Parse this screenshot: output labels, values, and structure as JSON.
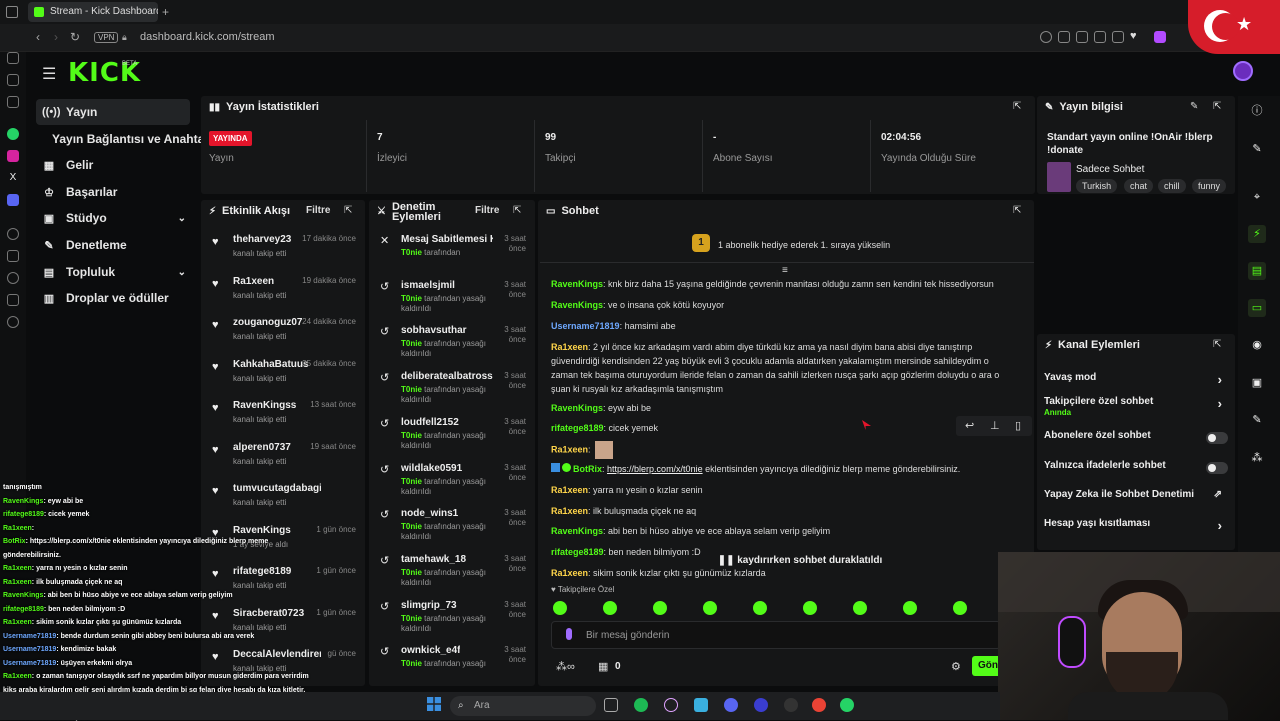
{
  "browser": {
    "tab_title": "Stream - Kick Dashboard",
    "new_tab": "+",
    "vpn": "VPN",
    "url": "dashboard.kick.com/stream"
  },
  "kick": {
    "logo": "KICK",
    "beta": "BETA"
  },
  "nav": [
    {
      "label": "Yayın",
      "icon": "broadcast-icon",
      "active": true
    },
    {
      "label": "Yayın Bağlantısı ve Anahtarı",
      "icon": "key-icon",
      "active": false
    },
    {
      "label": "Gelir",
      "icon": "chart-icon",
      "active": false
    },
    {
      "label": "Başarılar",
      "icon": "trophy-icon",
      "active": false
    },
    {
      "label": "Stüdyo",
      "icon": "studio-icon",
      "active": false,
      "chevron": true
    },
    {
      "label": "Denetleme",
      "icon": "wrench-icon",
      "active": false
    },
    {
      "label": "Topluluk",
      "icon": "community-icon",
      "active": false,
      "chevron": true
    },
    {
      "label": "Droplar ve ödüller",
      "icon": "gift-icon",
      "active": false
    }
  ],
  "stats": {
    "title": "Yayın İstatistikleri",
    "live_badge": "YAYINDA",
    "items": [
      {
        "value": "",
        "label": "Yayın"
      },
      {
        "value": "7",
        "label": "İzleyici"
      },
      {
        "value": "99",
        "label": "Takipçi"
      },
      {
        "value": "-",
        "label": "Abone Sayısı"
      },
      {
        "value": "02:04:56",
        "label": "Yayında Olduğu Süre"
      }
    ]
  },
  "stream_info": {
    "title": "Yayın bilgisi",
    "stream_title": "Standart yayın online !OnAir !blerp !donate",
    "category": "Sadece Sohbet",
    "tags": [
      "Turkish",
      "chat",
      "chill",
      "funny"
    ]
  },
  "activity": {
    "title": "Etkinlik Akışı",
    "filter": "Filtre",
    "items": [
      {
        "user": "theharvey23",
        "time": "17 dakika önce",
        "sub": "kanalı takip etti"
      },
      {
        "user": "Ra1xeen",
        "time": "19 dakika önce",
        "sub": "kanalı takip etti"
      },
      {
        "user": "zouganoguz07",
        "time": "24 dakika önce",
        "sub": "kanalı takip etti"
      },
      {
        "user": "KahkahaBatuus",
        "time": "35 dakika önce",
        "sub": "kanalı takip etti"
      },
      {
        "user": "RavenKingss",
        "time": "13 saat önce",
        "sub": "kanalı takip etti"
      },
      {
        "user": "alperen0737",
        "time": "19 saat önce",
        "sub": "kanalı takip etti"
      },
      {
        "user": "tumvucutagdabagimlisidiva",
        "time": "",
        "sub": "kanalı takip etti"
      },
      {
        "user": "RavenKings",
        "time": "1 gün önce",
        "sub": "1 ay seviye aldı"
      },
      {
        "user": "rifatege8189",
        "time": "1 gün önce",
        "sub": "kanalı takip etti"
      },
      {
        "user": "Siracberat0723",
        "time": "1 gün önce",
        "sub": "kanalı takip etti"
      },
      {
        "user": "DeccalAlevlendiren3131",
        "time": "gü önce",
        "sub": "kanalı takip etti"
      }
    ]
  },
  "mod": {
    "title": "Denetim Eylemleri",
    "filter": "Filtre",
    "by": "T0nie",
    "items": [
      {
        "user": "Mesaj Sabitlemesi Kaldırıldı",
        "time": "3 saat önce",
        "sub": "tarafından",
        "icon": "unpin-icon"
      },
      {
        "user": "ismaelsjmil",
        "time": "3 saat önce",
        "sub": "tarafından yasağı kaldırıldı",
        "icon": "undo-icon"
      },
      {
        "user": "sobhavsuthar",
        "time": "3 saat önce",
        "sub": "tarafından yasağı kaldırıldı",
        "icon": "undo-icon"
      },
      {
        "user": "deliberatealbatrossud",
        "time": "3 saat önce",
        "sub": "tarafından yasağı kaldırıldı",
        "icon": "undo-icon"
      },
      {
        "user": "loudfell2152",
        "time": "3 saat önce",
        "sub": "tarafından yasağı kaldırıldı",
        "icon": "undo-icon"
      },
      {
        "user": "wildlake0591",
        "time": "3 saat önce",
        "sub": "tarafından yasağı kaldırıldı",
        "icon": "undo-icon"
      },
      {
        "user": "node_wins1",
        "time": "3 saat önce",
        "sub": "tarafından yasağı kaldırıldı",
        "icon": "undo-icon"
      },
      {
        "user": "tamehawk_18",
        "time": "3 saat önce",
        "sub": "tarafından yasağı kaldırıldı",
        "icon": "undo-icon"
      },
      {
        "user": "slimgrip_73",
        "time": "3 saat önce",
        "sub": "tarafından yasağı kaldırıldı",
        "icon": "undo-icon"
      },
      {
        "user": "ownkick_e4f",
        "time": "3 saat önce",
        "sub": "tarafından yasağı",
        "icon": "undo-icon"
      }
    ]
  },
  "chat": {
    "title": "Sohbet",
    "gift_banner": "1 abonelik hediye ederek 1. sıraya yükselin",
    "gift_num": "1",
    "paused": "kaydırırken sohbet duraklatıldı",
    "followers_only": "Takipçilere Özel",
    "input_placeholder": "Bir mesaj gönderin",
    "send": "Gön",
    "points": "0",
    "messages": [
      {
        "user": "RavenKings",
        "color": "green",
        "text": ": knk birz daha 15 yaşına geldiğinde çevrenin manitası olduğu zamn sen kendini tek hissediyorsun"
      },
      {
        "user": "RavenKings",
        "color": "green",
        "text": ": ve o insana çok kötü koyuyor"
      },
      {
        "user": "Username71819",
        "color": "blue",
        "text": ": hamsimi abe"
      },
      {
        "user": "Ra1xeen",
        "color": "gold",
        "text": ": 2 yıl önce kız arkadaşım vardı abim diye türkdü kız ama ya nasıl diyim bana abisi diye tanıştırıp güvendirdiği kendisinden 22 yaş büyük evli 3 çocuklu adamla aldatırken yakalamıştım mersinde sahildeydim o zaman tek başıma oturuyordum ileride felan o zaman da sahili izlerken rusça şarkı açıp gözlerim doluydu o ara o şuan ki rusyalı kız arkadaşımla tanışmıştım"
      },
      {
        "user": "RavenKings",
        "color": "green",
        "text": ": eyw abi be"
      },
      {
        "user": "rifatege8189",
        "color": "green",
        "text": ": cicek yemek"
      },
      {
        "user": "Ra1xeen",
        "color": "gold",
        "text": ":"
      },
      {
        "user": "BotRix",
        "color": "green",
        "text": ":",
        "link": "https://blerp.com/x/t0nie",
        "after": " eklentisinden yayıncıya dilediğiniz blerp meme gönderebilirsiniz."
      },
      {
        "user": "Ra1xeen",
        "color": "gold",
        "text": ": yarra nı yesin o kızlar senin"
      },
      {
        "user": "Ra1xeen",
        "color": "gold",
        "text": ": ilk buluşmada çiçek ne aq"
      },
      {
        "user": "RavenKings",
        "color": "green",
        "text": ": abi ben bi hüso abiye ve ece ablaya selam verip geliyim"
      },
      {
        "user": "rifatege8189",
        "color": "green",
        "text": ": ben neden bilmiyom :D"
      },
      {
        "user": "Ra1xeen",
        "color": "gold",
        "text": ": sikim sonik kızlar çıktı şu günümüz kızlarda"
      }
    ]
  },
  "channel_actions": {
    "title": "Kanal Eylemleri",
    "items": [
      {
        "label": "Yavaş mod",
        "kind": "chevron",
        "sub": ""
      },
      {
        "label": "Takipçilere özel sohbet",
        "kind": "chevron",
        "sub": "Anında"
      },
      {
        "label": "Abonelere özel sohbet",
        "kind": "toggle",
        "sub": ""
      },
      {
        "label": "Yalnızca ifadelerle sohbet",
        "kind": "toggle",
        "sub": ""
      },
      {
        "label": "Yapay Zeka ile Sohbet Denetimi",
        "kind": "external",
        "sub": ""
      },
      {
        "label": "Hesap yaşı kısıtlaması",
        "kind": "chevron",
        "sub": ""
      }
    ]
  },
  "overlay": [
    {
      "user": "",
      "text": "tanışmıştım",
      "c": ""
    },
    {
      "user": "RavenKings",
      "text": ": eyw abi be",
      "c": "g"
    },
    {
      "user": "rifatege8189",
      "text": ": cicek yemek",
      "c": "g"
    },
    {
      "user": "Ra1xeen",
      "text": ":",
      "c": "g"
    },
    {
      "user": "BotRix",
      "text": ": https://blerp.com/x/t0nie eklentisinden yayıncıya dilediğiniz blerp meme",
      "c": "g"
    },
    {
      "user": "",
      "text": "gönderebilirsiniz.",
      "c": ""
    },
    {
      "user": "Ra1xeen",
      "text": ": yarra nı yesin o kızlar senin",
      "c": "g"
    },
    {
      "user": "Ra1xeen",
      "text": ": ilk buluşmada çiçek ne aq",
      "c": "g"
    },
    {
      "user": "RavenKings",
      "text": ": abi ben bi hüso abiye ve ece ablaya selam verip geliyim",
      "c": "g"
    },
    {
      "user": "rifatege8189",
      "text": ": ben neden bilmiyom :D",
      "c": "g"
    },
    {
      "user": "Ra1xeen",
      "text": ": sikim sonik kızlar çıktı şu günümüz kızlarda",
      "c": "g"
    },
    {
      "user": "Username71819",
      "text": ": bende durdum senin gibi abbey beni bulursa abi ara verek",
      "c": "b"
    },
    {
      "user": "Username71819",
      "text": ": kendimize bakak",
      "c": "b"
    },
    {
      "user": "Username71819",
      "text": ": üşüyen erkekmi olrya",
      "c": "b"
    },
    {
      "user": "Ra1xeen",
      "text": ": o zaman tanışıyor olsaydık ssrf ne yapardım billyor musun giderdim para verirdim",
      "c": "g"
    },
    {
      "user": "",
      "text": "kiks araba kiralardım gelir seni alırdım kızada derdim bi sg felan diye hesabı da kıza kitletir,",
      "c": ""
    },
    {
      "user": "",
      "text": "sende alırgötürürdüm",
      "c": ""
    },
    {
      "user": "Ra1xeen",
      "text": ": abi bende aşıldım",
      "c": "g"
    }
  ],
  "taskbar": {
    "search": "Ara"
  }
}
